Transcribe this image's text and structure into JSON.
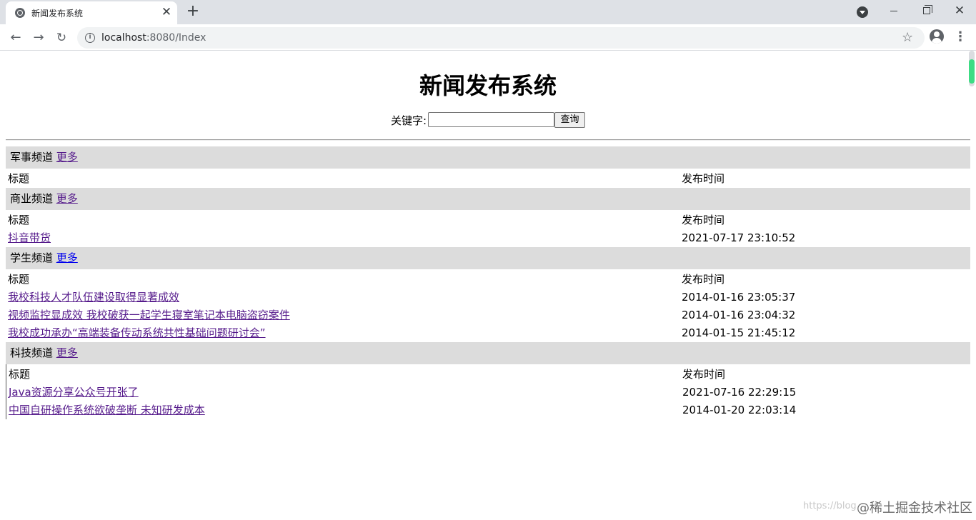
{
  "browser": {
    "tab_title": "新闻发布系统",
    "url_host": "localhost",
    "url_rest": ":8080/Index"
  },
  "page": {
    "title": "新闻发布系统",
    "search": {
      "label": "关键字:",
      "value": "",
      "button": "查询"
    },
    "title_header": "标题",
    "time_header": "发布时间",
    "more_label": "更多"
  },
  "channels": [
    {
      "name": "军事频道",
      "items": []
    },
    {
      "name": "商业频道",
      "items": [
        {
          "title": "抖音带货",
          "time": "2021-07-17 23:10:52"
        }
      ]
    },
    {
      "name": "学生频道",
      "items": [
        {
          "title": "我校科技人才队伍建设取得显著成效",
          "time": "2014-01-16 23:05:37"
        },
        {
          "title": "视频监控显成效 我校破获一起学生寝室笔记本电脑盗窃案件",
          "time": "2014-01-16 23:04:32"
        },
        {
          "title": "我校成功承办“高端装备传动系统共性基础问题研讨会”",
          "time": "2014-01-15 21:45:12"
        }
      ]
    },
    {
      "name": "科技频道",
      "items": [
        {
          "title": "Java资源分享公众号开张了",
          "time": "2021-07-16 22:29:15"
        },
        {
          "title": "中国自研操作系统欲破垄断 未知研发成本",
          "time": "2014-01-20 22:03:14"
        }
      ]
    }
  ],
  "watermark": {
    "url_text": "https://blog",
    "brand": "@稀土掘金技术社区"
  },
  "icons": {
    "tab_favicon": "globe-icon",
    "back": "arrow-left-icon",
    "forward": "arrow-right-icon",
    "reload": "reload-icon",
    "info": "info-icon",
    "bookmark": "star-icon",
    "profile": "avatar-icon",
    "menu": "kebab-icon"
  }
}
